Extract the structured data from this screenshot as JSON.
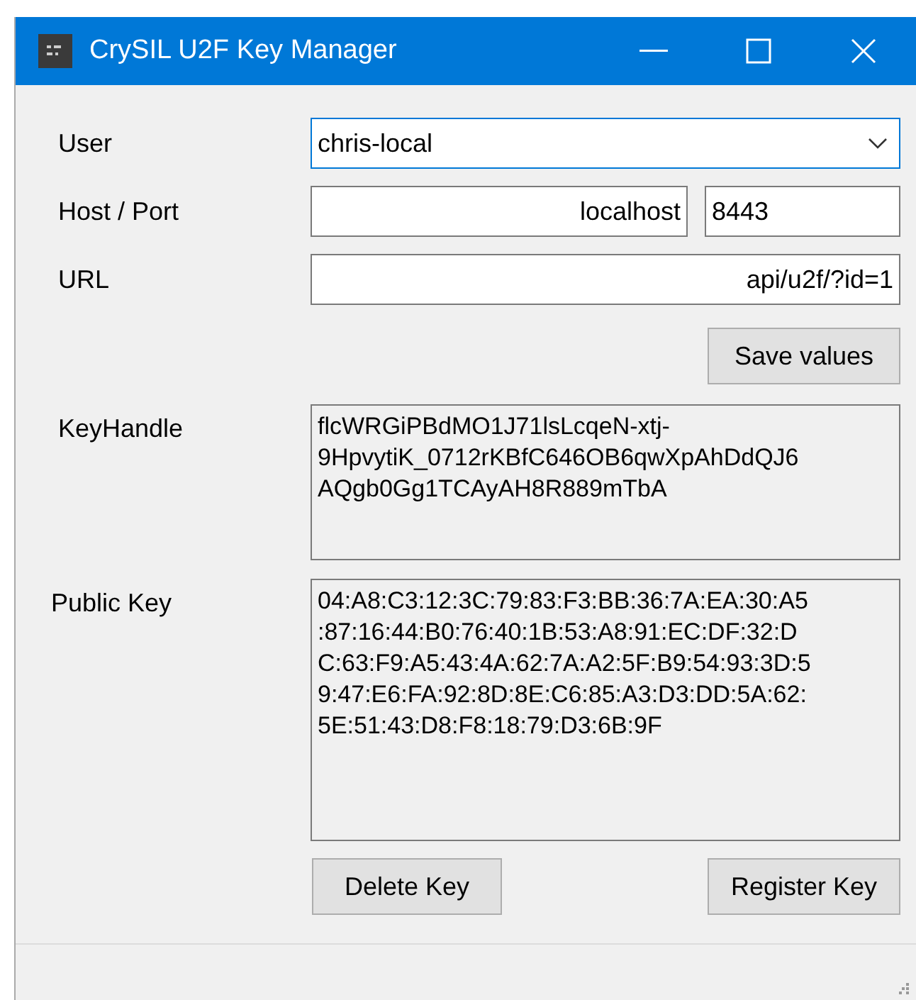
{
  "window": {
    "title": "CrySIL U2F Key Manager"
  },
  "fields": [
    {
      "label": "User",
      "value": "chris-local",
      "kind": "combo",
      "focused": true
    },
    {
      "label": "Host / Port",
      "value": "localhost",
      "port": "8443",
      "kind": "hostport",
      "focused": false
    },
    {
      "label": "URL",
      "value": "api/u2f/?id=1",
      "kind": "text",
      "focused": false
    }
  ],
  "save_button": "Save values",
  "key_handle": {
    "label": "KeyHandle",
    "lines": [
      "flcWRGiPBdMO1J71lsLcqeN-xtj-",
      "9HpvytiK_0712rKBfC646OB6qwXpAhDdQJ6",
      "AQgb0Gg1TCAyAH8R889mTbA"
    ]
  },
  "public_key": {
    "label": "Public Key",
    "lines": [
      "04:A8:C3:12:3C:79:83:F3:BB:36:7A:EA:30:A5",
      ":87:16:44:B0:76:40:1B:53:A8:91:EC:DF:32:D",
      "C:63:F9:A5:43:4A:62:7A:A2:5F:B9:54:93:3D:5",
      "9:47:E6:FA:92:8D:8E:C6:85:A3:D3:DD:5A:62:",
      "5E:51:43:D8:F8:18:79:D3:6B:9F"
    ]
  },
  "buttons": [
    "Delete Key",
    "Register Key"
  ]
}
